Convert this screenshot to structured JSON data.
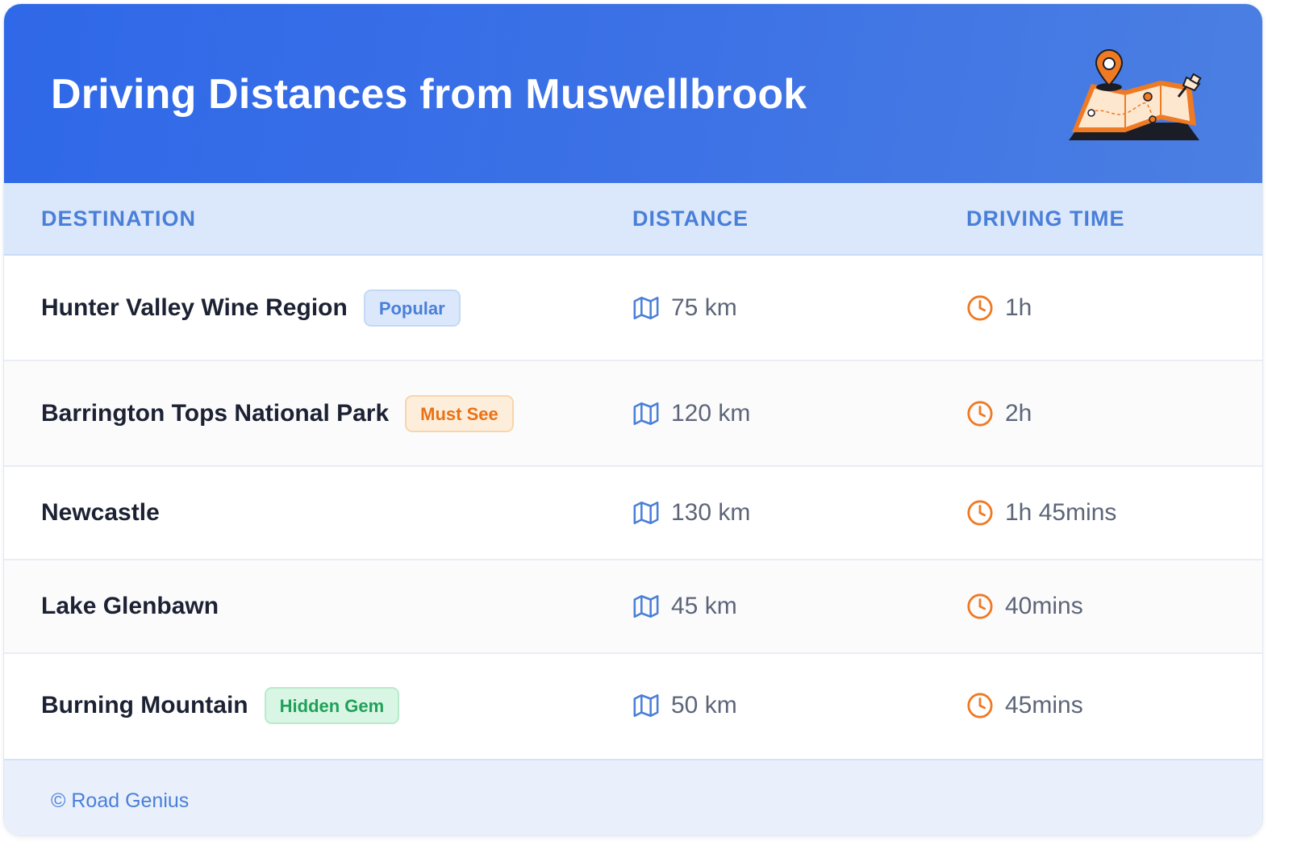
{
  "header": {
    "title": "Driving Distances from Muswellbrook",
    "illustration_icon": "map-with-pins-icon"
  },
  "table": {
    "columns": [
      "DESTINATION",
      "DISTANCE",
      "DRIVING TIME"
    ],
    "rows": [
      {
        "destination": "Hunter Valley Wine Region",
        "badge": "Popular",
        "badge_color": "#4a7fd8",
        "distance": "75 km",
        "time": "1h"
      },
      {
        "destination": "Barrington Tops National Park",
        "badge": "Must See",
        "badge_color": "#ea7216",
        "distance": "120 km",
        "time": "2h"
      },
      {
        "destination": "Newcastle",
        "badge": "",
        "distance": "130 km",
        "time": "1h 45mins"
      },
      {
        "destination": "Lake Glenbawn",
        "badge": "",
        "distance": "45 km",
        "time": "40mins"
      },
      {
        "destination": "Burning Mountain",
        "badge": "Hidden Gem",
        "badge_color": "#1fa15a",
        "distance": "50 km",
        "time": "45mins"
      }
    ],
    "distance_icon": "map-icon",
    "time_icon": "clock-icon"
  },
  "footer": {
    "copyright": "© Road Genius"
  },
  "colors": {
    "header_gradient_start": "#2f68e8",
    "header_gradient_end": "#4b7fe2",
    "accent_blue": "#4a7fd8",
    "accent_orange": "#ea7216",
    "accent_green": "#1fa15a"
  }
}
